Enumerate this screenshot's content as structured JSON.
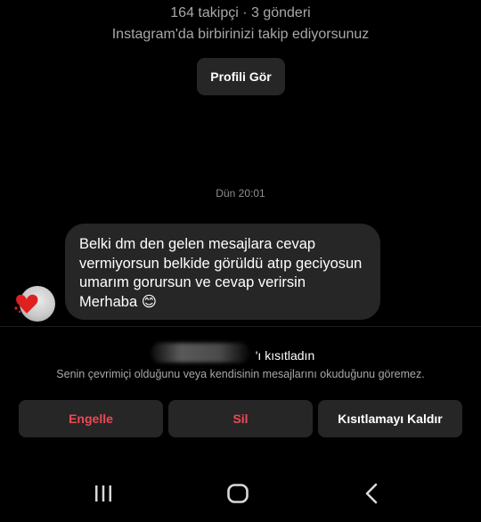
{
  "profile": {
    "stats": "164 takipçi · 3 gönderi",
    "mutual_text": "Instagram'da birbirinizi takip ediyorsunuz",
    "view_profile_label": "Profili Gör"
  },
  "chat": {
    "timestamp": "Dün 20:01",
    "message": {
      "text": "Belki dm den gelen mesajlara cevap vermiyorsun belkide görüldü atıp geciyosun umarım gorursun ve cevap verirsin Merhaba 😊"
    }
  },
  "restriction": {
    "title": "'ı kısıtladın",
    "description": "Senin çevrimiçi olduğunu veya kendisinin mesajlarını okuduğunu göremez.",
    "actions": {
      "block": "Engelle",
      "delete": "Sil",
      "unrestrict": "Kısıtlamayı Kaldır"
    }
  },
  "navbar": {
    "items": [
      "recent-apps-icon",
      "home-icon",
      "back-icon"
    ]
  },
  "colors": {
    "background": "#000000",
    "surface": "#262626",
    "danger": "#ed4956",
    "muted": "#a8a8a8"
  }
}
